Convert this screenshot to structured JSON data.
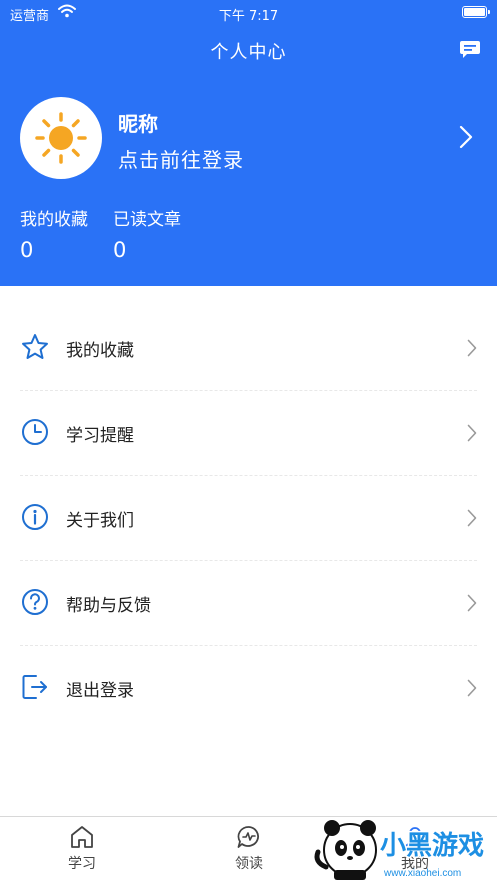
{
  "status_bar": {
    "carrier": "运营商",
    "time": "下午 7:17"
  },
  "nav": {
    "title": "个人中心",
    "message_icon": "chat-message-icon"
  },
  "profile": {
    "nickname": "昵称",
    "login_prompt": "点击前往登录",
    "avatar_icon": "sun-icon"
  },
  "stats": [
    {
      "label": "我的收藏",
      "value": "0"
    },
    {
      "label": "已读文章",
      "value": "0"
    }
  ],
  "menu": [
    {
      "label": "我的收藏",
      "icon": "star-icon"
    },
    {
      "label": "学习提醒",
      "icon": "clock-icon"
    },
    {
      "label": "关于我们",
      "icon": "info-icon"
    },
    {
      "label": "帮助与反馈",
      "icon": "help-icon"
    },
    {
      "label": "退出登录",
      "icon": "logout-icon"
    }
  ],
  "tabs": [
    {
      "label": "学习",
      "icon": "home-icon"
    },
    {
      "label": "领读",
      "icon": "chat-pulse-icon"
    },
    {
      "label": "我的",
      "icon": "user-icon"
    }
  ],
  "watermark": {
    "brand": "小黑游戏",
    "url": "www.xiaohei.com"
  },
  "colors": {
    "primary": "#2a72f6",
    "icon_blue": "#1f6fd1",
    "sun": "#f5a623"
  }
}
